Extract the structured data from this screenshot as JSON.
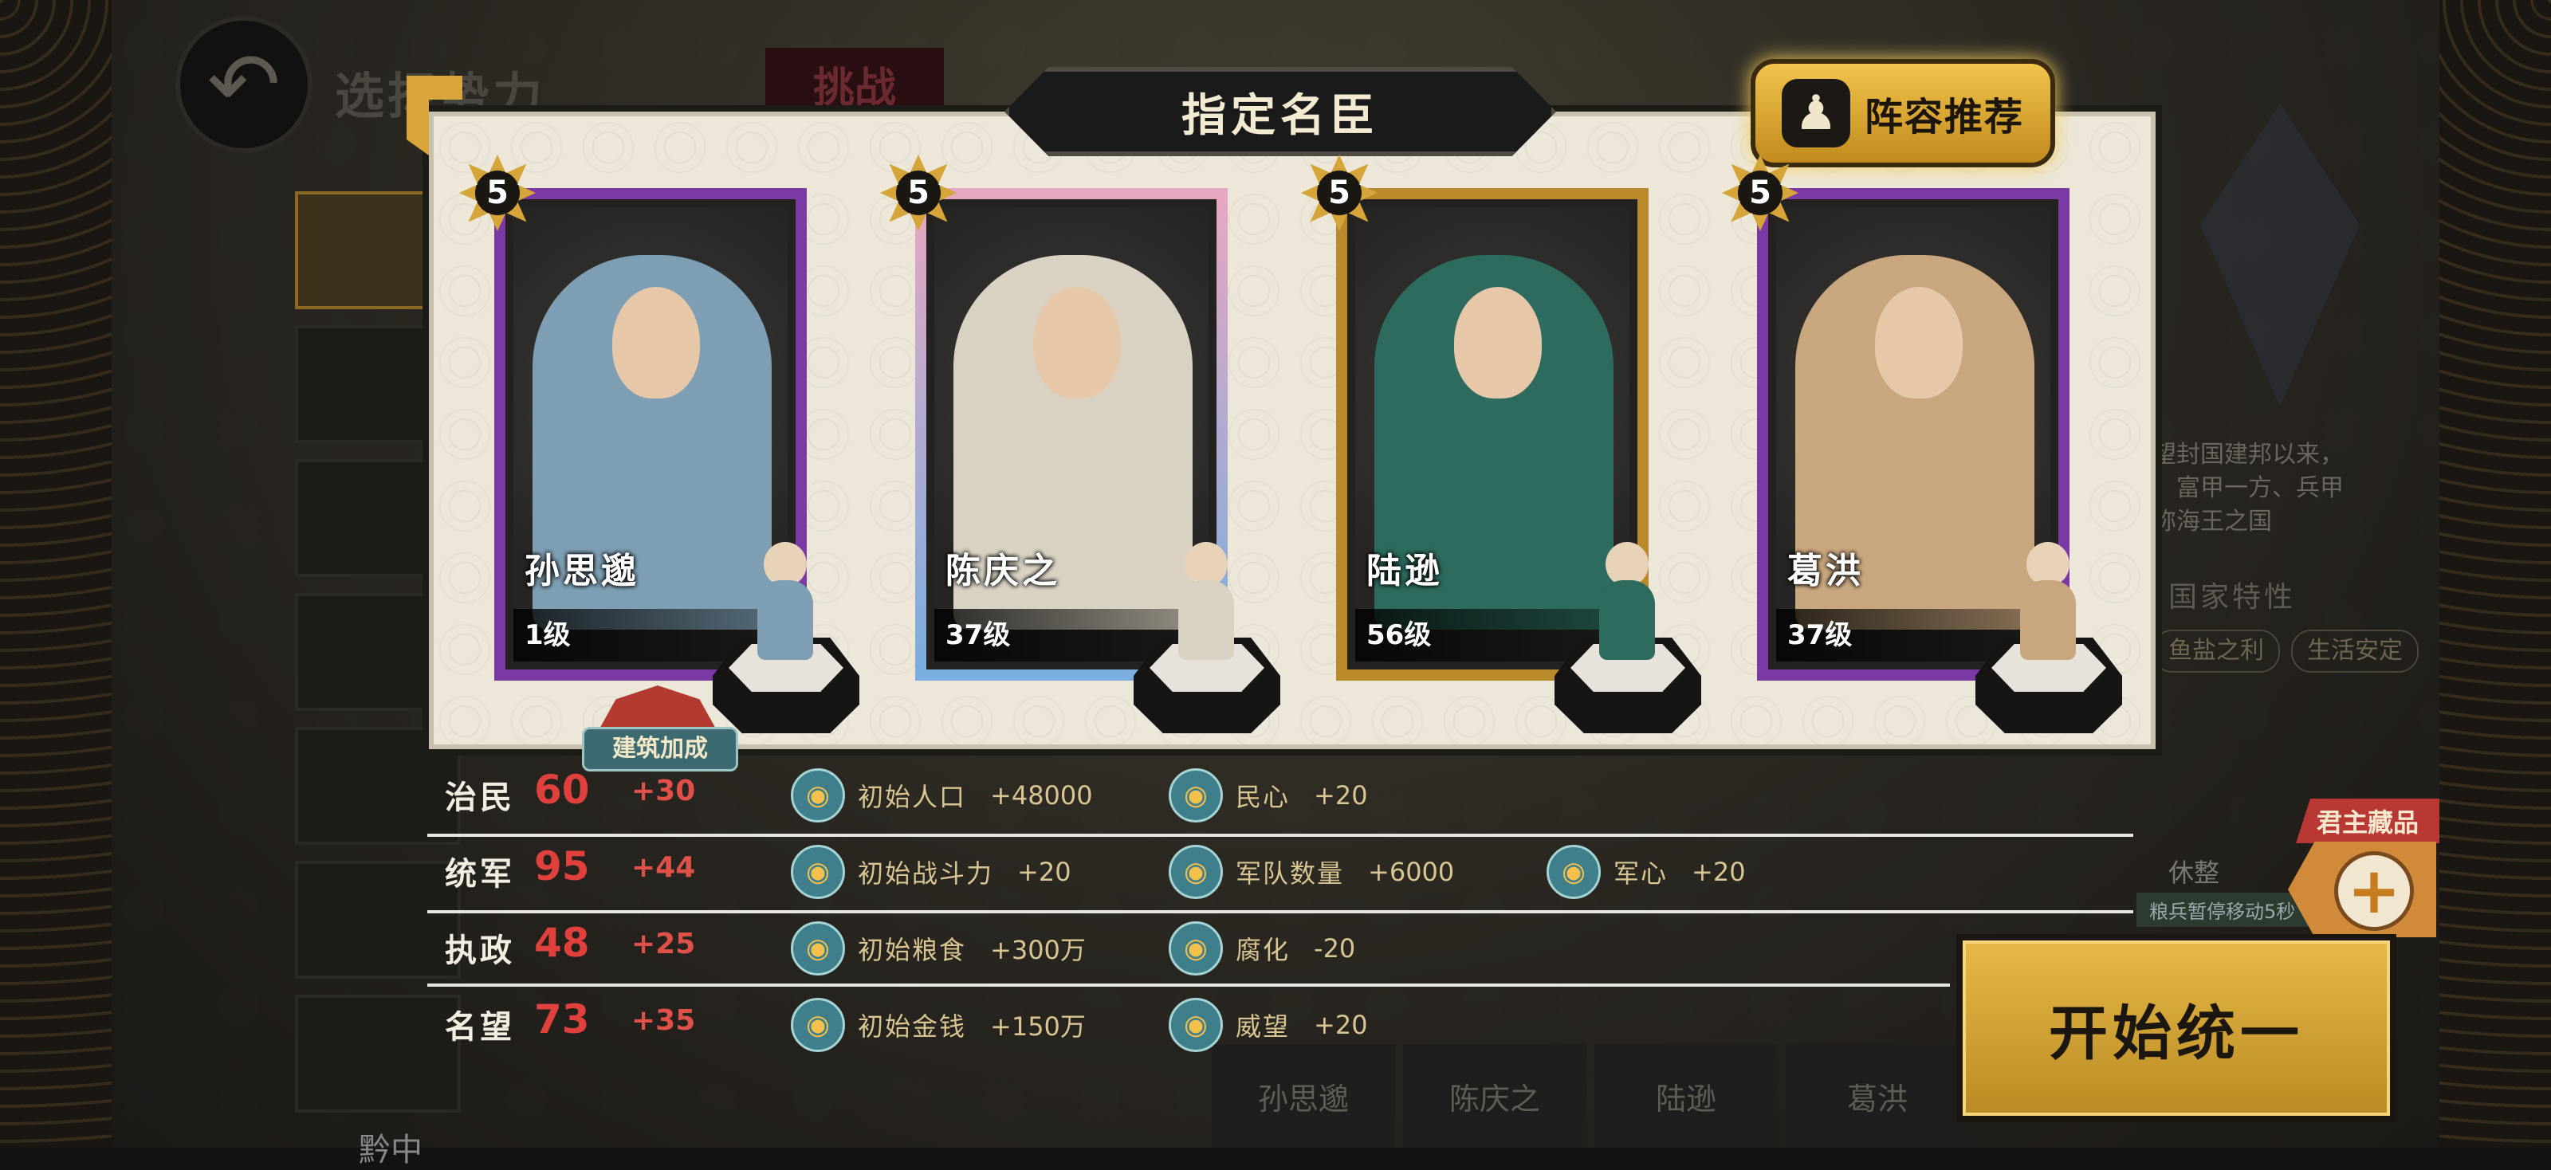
{
  "background": {
    "title": "选择势力",
    "challenge_tab": "挑战",
    "nation_desc": "望封国建邦以来，\n，富甲一方、兵甲\n称海王之国",
    "nation_traits_title": "国家特性",
    "traits": [
      "鱼盐之利",
      "生活安定"
    ],
    "rest_label": "休整",
    "rest_sub": "粮兵暂停移动5秒",
    "bottom_tabs": [
      "孙思邈",
      "陈庆之",
      "陆逊",
      "葛洪"
    ],
    "bottom_left_text": "黔中"
  },
  "dialog": {
    "title": "指定名臣",
    "lineup_button": "阵容推荐",
    "building_bonus": "建筑加成"
  },
  "cards": [
    {
      "name": "孙思邈",
      "level": "1级",
      "stars": "5",
      "frame": "purple",
      "robe": "#7e9fb3"
    },
    {
      "name": "陈庆之",
      "level": "37级",
      "stars": "5",
      "frame": "blue-pink",
      "robe": "#d9d2c2"
    },
    {
      "name": "陆逊",
      "level": "56级",
      "stars": "5",
      "frame": "gold",
      "robe": "#2d6b5e"
    },
    {
      "name": "葛洪",
      "level": "37级",
      "stars": "5",
      "frame": "purple",
      "robe": "#c9a77e"
    }
  ],
  "stats": [
    {
      "name": "治民",
      "value": "60",
      "bonus": "+30",
      "effects": [
        {
          "icon": "population-icon",
          "label": "初始人口",
          "value": "+48000"
        },
        {
          "icon": "heart-icon",
          "label": "民心",
          "value": "+20"
        }
      ]
    },
    {
      "name": "统军",
      "value": "95",
      "bonus": "+44",
      "effects": [
        {
          "icon": "pickaxe-icon",
          "label": "初始战斗力",
          "value": "+20"
        },
        {
          "icon": "troops-icon",
          "label": "军队数量",
          "value": "+6000"
        },
        {
          "icon": "helmet-icon",
          "label": "军心",
          "value": "+20"
        }
      ]
    },
    {
      "name": "执政",
      "value": "48",
      "bonus": "+25",
      "effects": [
        {
          "icon": "grain-icon",
          "label": "初始粮食",
          "value": "+300万"
        },
        {
          "icon": "hand-icon",
          "label": "腐化",
          "value": "-20"
        }
      ]
    },
    {
      "name": "名望",
      "value": "73",
      "bonus": "+35",
      "effects": [
        {
          "icon": "coin-icon",
          "label": "初始金钱",
          "value": "+150万"
        },
        {
          "icon": "medal-icon",
          "label": "威望",
          "value": "+20"
        }
      ]
    }
  ],
  "treasure": {
    "tag": "君主藏品",
    "plus": "+"
  },
  "start_button": "开始统一",
  "colors": {
    "accent_gold": "#e7b947",
    "stat_red": "#e0413c",
    "purple_frame": "#7a3aa4"
  }
}
